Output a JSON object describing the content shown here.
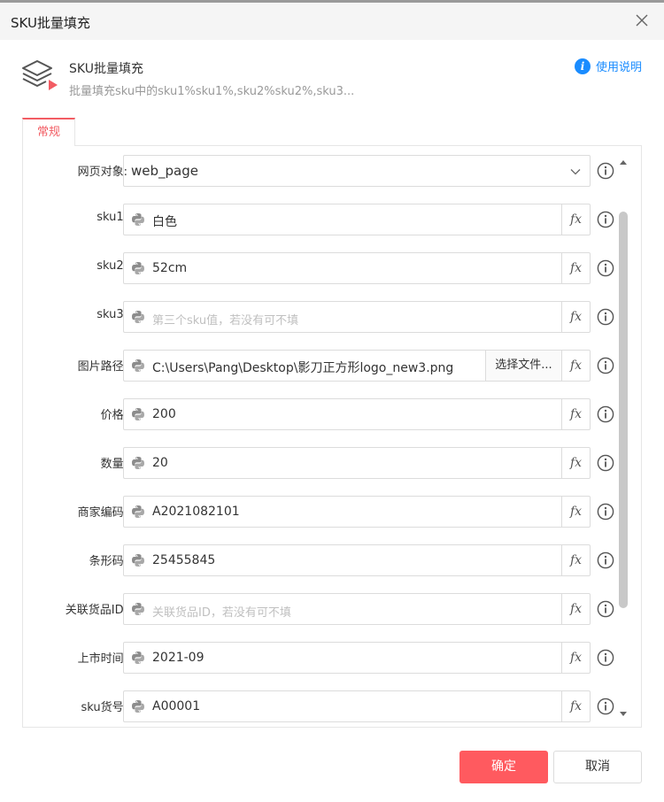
{
  "window": {
    "title": "SKU批量填充"
  },
  "header": {
    "title": "SKU批量填充",
    "description": "批量填充sku中的sku1%sku1%,sku2%sku2%,sku3...",
    "help_label": "使用说明"
  },
  "tabs": [
    {
      "label": "常规"
    }
  ],
  "form": {
    "web_object": {
      "label": "网页对象:",
      "value": "web_page"
    },
    "fields": [
      {
        "label": "sku1:",
        "value": "白色",
        "placeholder": false
      },
      {
        "label": "sku2:",
        "value": "52cm",
        "placeholder": false
      },
      {
        "label": "sku3:",
        "value": "第三个sku值，若没有可不填",
        "placeholder": true
      },
      {
        "label": "图片路径:",
        "value": "C:\\Users\\Pang\\Desktop\\影刀正方形logo_new3.png",
        "placeholder": false,
        "file_button": "选择文件..."
      },
      {
        "label": "价格:",
        "value": "200",
        "placeholder": false
      },
      {
        "label": "数量:",
        "value": "20",
        "placeholder": false
      },
      {
        "label": "商家编码:",
        "value": "A2021082101",
        "placeholder": false
      },
      {
        "label": "条形码:",
        "value": "25455845",
        "placeholder": false
      },
      {
        "label": "关联货品ID:",
        "value": "关联货品ID，若没有可不填",
        "placeholder": true
      },
      {
        "label": "上市时间:",
        "value": "2021-09",
        "placeholder": false
      },
      {
        "label": "sku货号:",
        "value": "A00001",
        "placeholder": false
      }
    ],
    "fx_label": "fx"
  },
  "footer": {
    "confirm_label": "确定",
    "cancel_label": "取消"
  },
  "colors": {
    "accent": "#f25c63",
    "confirm_bg": "#ff5a5f",
    "help_blue": "#1a8cff"
  }
}
